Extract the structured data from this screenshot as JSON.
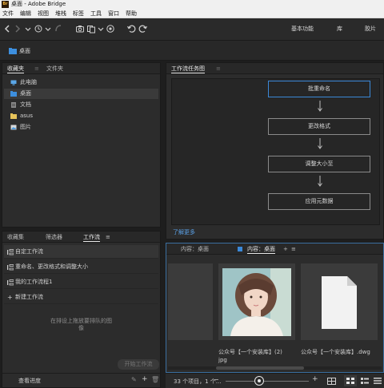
{
  "window": {
    "app_icon_text": "Br",
    "title": "桌面 - Adobe Bridge"
  },
  "menu": [
    "文件",
    "编辑",
    "视图",
    "堆栈",
    "标签",
    "工具",
    "窗口",
    "帮助"
  ],
  "toolbar": {
    "workspaces": [
      "基本功能",
      "库",
      "胶片"
    ]
  },
  "path": {
    "current": "桌面"
  },
  "favorites_panel": {
    "tabs": [
      "收藏夹",
      "文件夹"
    ],
    "items": [
      {
        "label": "此电脑",
        "icon": "computer-icon"
      },
      {
        "label": "桌面",
        "icon": "folder-blue-icon",
        "selected": true
      },
      {
        "label": "文档",
        "icon": "document-icon"
      },
      {
        "label": "asus",
        "icon": "folder-yellow-icon"
      },
      {
        "label": "图片",
        "icon": "pictures-icon"
      }
    ]
  },
  "workflow_diagram": {
    "tab": "工作流任务图",
    "steps": [
      "批重命名",
      "更改格式",
      "调整大小至",
      "应用元数据"
    ],
    "learn_more": "了解更多"
  },
  "workflow_panel": {
    "tabs": [
      "收藏集",
      "筛选器",
      "工作流"
    ],
    "active_tab": "工作流",
    "items": [
      {
        "label": "自定工作流",
        "selected": true
      },
      {
        "label": "重命名、更改格式和调整大小"
      },
      {
        "label": "我的工作流程1"
      }
    ],
    "new_workflow": "新建工作流",
    "drop_hint_line1": "在排设上拖放要排队的图",
    "drop_hint_line2": "像",
    "start_button": "开始工作流",
    "view_progress": "查看进度"
  },
  "content_panel": {
    "tabs": [
      "内容：桌面",
      "内容：桌面"
    ],
    "files": [
      {
        "name_line1": "公众号【一个安装库】(2)",
        "name_line2": "jpg",
        "type": "image"
      },
      {
        "name_line1": "公众号【一个安装库】.dwg",
        "name_line2": "",
        "type": "document"
      }
    ]
  },
  "status": {
    "item_count": "33 个项目，1 个..."
  },
  "colors": {
    "accent_blue": "#3b88d8",
    "panel_bg": "#2c2c2c",
    "app_bg": "#1e1e1e",
    "link_blue": "#5aa0e6"
  }
}
